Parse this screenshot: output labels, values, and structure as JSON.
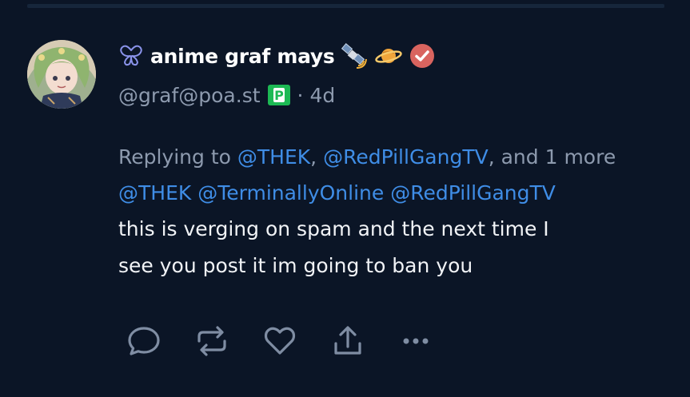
{
  "post": {
    "author": {
      "display_name": "anime graf mays",
      "handle": "@graf@poa.st",
      "time_separator": "·",
      "age": "4d",
      "icon_left": "butterfly-icon",
      "emojis": [
        "satellite-emoji",
        "ringed-planet-emoji",
        "verified-check-badge"
      ],
      "instance_badge": "P"
    },
    "reply": {
      "prefix": "Replying to",
      "mention1": "@THEK",
      "sep1": ",",
      "mention2": "@RedPillGangTV",
      "suffix": ", and 1 more"
    },
    "mentions": [
      "@THEK",
      "@TerminallyOnline",
      "@RedPillGangTV"
    ],
    "body_lines": [
      "this is verging on spam and the next time I",
      "see you post it im going to ban you"
    ],
    "actions": [
      "reply-icon",
      "repost-icon",
      "like-icon",
      "share-icon",
      "more-icon"
    ]
  },
  "colors": {
    "background": "#0b1526",
    "text": "#f1f3f6",
    "muted": "#8d9aae",
    "link": "#3f8de6",
    "verified": "#d9645f",
    "instance_badge": "#1db954"
  }
}
